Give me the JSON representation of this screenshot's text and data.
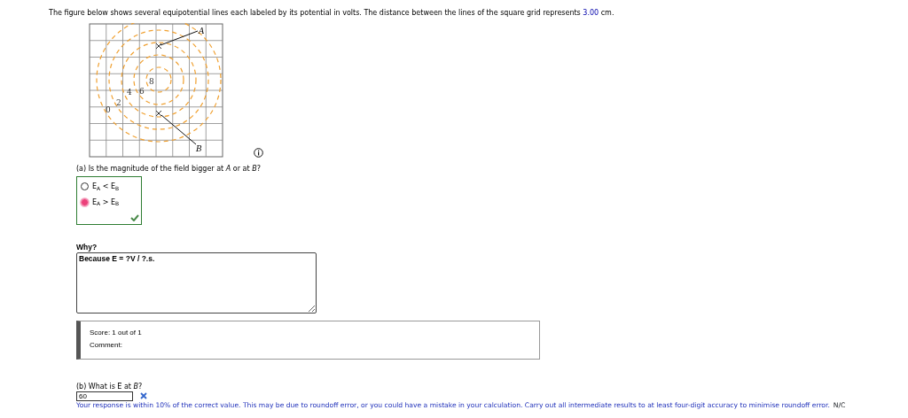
{
  "intro": {
    "text": "The figure below shows several equipotential lines each labeled by its potential in volts. The distance between the lines of the square grid represents",
    "value": "3.00",
    "unit": "cm."
  },
  "figure": {
    "contour_labels": [
      "8",
      "6",
      "4",
      "2",
      "0"
    ],
    "point_labels": [
      "A",
      "B"
    ]
  },
  "part_a": {
    "question": "(a) Is the magnitude of the field bigger at *A* or at *B*?",
    "correct": true,
    "options": [
      {
        "label": "E$_{A}$ < E$_{B}$",
        "selected": false
      },
      {
        "label": "E$_{A}$ > E$_{B}$",
        "selected": true
      }
    ]
  },
  "why": {
    "label": "Why?",
    "value": "Because E = ?V / ?.s."
  },
  "score": {
    "score": "Score: 1 out of 1",
    "comment": "Comment:"
  },
  "part_b": {
    "question": "(b) What is E⃗ at *B*?",
    "value": "60",
    "correct": false,
    "feedback": "Your response is within 10% of the correct value. This may be due to roundoff error, or you could have a mistake in your calculation. Carry out all intermediate results to at least four-digit accuracy to minimise roundoff error.",
    "units": "N/C"
  }
}
